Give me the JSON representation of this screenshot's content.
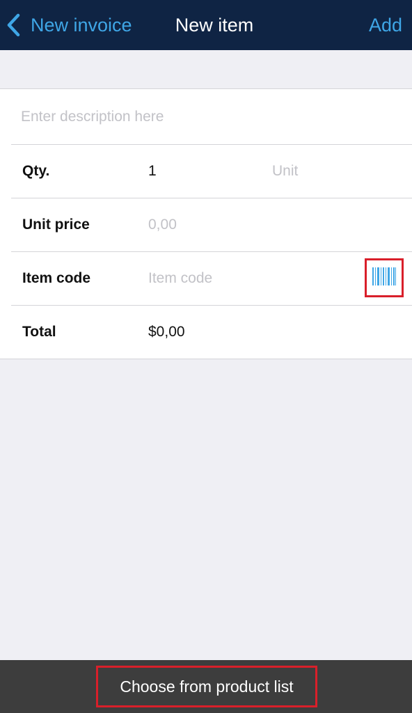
{
  "nav": {
    "back_label": "New invoice",
    "title": "New item",
    "add_label": "Add"
  },
  "form": {
    "description_placeholder": "Enter description here",
    "qty": {
      "label": "Qty.",
      "value": "1",
      "unit_placeholder": "Unit"
    },
    "unit_price": {
      "label": "Unit price",
      "placeholder": "0,00"
    },
    "item_code": {
      "label": "Item code",
      "placeholder": "Item code",
      "scan_icon": "barcode-icon"
    },
    "total": {
      "label": "Total",
      "value": "$0,00"
    }
  },
  "bottom": {
    "product_list_label": "Choose from product list"
  },
  "colors": {
    "nav_background": "#0f2444",
    "accent": "#3fa6e6",
    "highlight": "#d91f2a",
    "bottom_bar": "#3d3d3d"
  }
}
